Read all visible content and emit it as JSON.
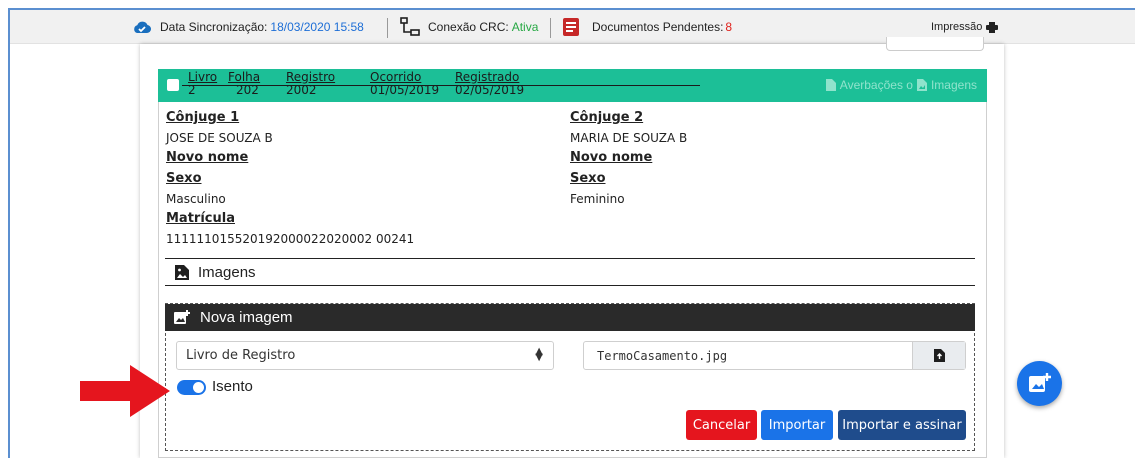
{
  "topbar": {
    "sync_label": "Data Sincronização:",
    "sync_value": "18/03/2020 15:58",
    "crc_label": "Conexão CRC:",
    "crc_value": "Ativa",
    "docs_label": "Documentos Pendentes:",
    "docs_value": "8",
    "print_label": "Impressão"
  },
  "registro": {
    "columns": [
      {
        "title": "Livro",
        "value": "2"
      },
      {
        "title": "Folha",
        "value": "202"
      },
      {
        "title": "Registro",
        "value": "2002"
      },
      {
        "title": "Ocorrido",
        "value": "01/05/2019"
      },
      {
        "title": "Registrado",
        "value": "02/05/2019"
      }
    ],
    "actions_label": "Averbações o",
    "images_label": "Imagens",
    "conjuge1": {
      "label": "Cônjuge 1",
      "name": "JOSE DE SOUZA B",
      "novo_nome_label": "Novo nome",
      "sexo_label": "Sexo",
      "sexo": "Masculino",
      "matricula_label": "Matrícula",
      "matricula": "111111015520192000022020002 00241"
    },
    "conjuge2": {
      "label": "Cônjuge 2",
      "name": "MARIA DE SOUZA B",
      "novo_nome_label": "Novo nome",
      "sexo_label": "Sexo",
      "sexo": "Feminino"
    }
  },
  "imagens_section": {
    "title": "Imagens"
  },
  "nova_imagem": {
    "title": "Nova imagem",
    "select_value": "Livro de Registro",
    "file_value": "TermoCasamento.jpg",
    "isento_label": "Isento",
    "isento_on": true,
    "cancel_label": "Cancelar",
    "import_label": "Importar",
    "import_sign_label": "Importar e assinar"
  },
  "colors": {
    "header_green": "#1cbf97",
    "primary_blue": "#1a73e8",
    "dark_blue": "#1f4c8c",
    "cancel_red": "#e5151e",
    "arrow_red": "#e5151e"
  }
}
